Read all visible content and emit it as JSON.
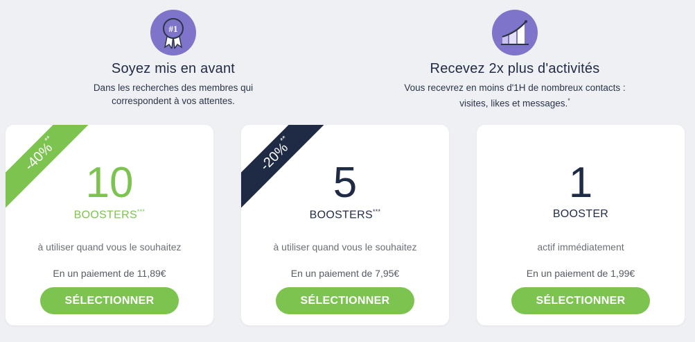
{
  "colors": {
    "background": "#eef0f4",
    "accent_green": "#7cc44f",
    "navy": "#1f2a44",
    "icon_purple": "#7e74c9"
  },
  "features": [
    {
      "icon": "award-ribbon-icon",
      "icon_text": "#1",
      "title": "Soyez mis en avant",
      "line1": "Dans les recherches des membres qui",
      "line2": "correspondent à vos attentes.",
      "footnote": ""
    },
    {
      "icon": "growth-chart-icon",
      "title": "Recevez 2x plus d'activités",
      "line1": "Vous recevrez en moins d'1H de nombreux contacts :",
      "line2": "visites, likes et messages.",
      "footnote": "*"
    }
  ],
  "offers": [
    {
      "ribbon": "-40%",
      "ribbon_mark": "**",
      "ribbon_color": "#7cc44f",
      "count": "10",
      "unit": "BOOSTERS",
      "unit_mark": "***",
      "description": "à utiliser quand vous le souhaitez",
      "price": "En un paiement de 11,89€",
      "button": "SÉLECTIONNER"
    },
    {
      "ribbon": "-20%",
      "ribbon_mark": "**",
      "ribbon_color": "#1f2a44",
      "count": "5",
      "unit": "BOOSTERS",
      "unit_mark": "***",
      "description": "à utiliser quand vous le souhaitez",
      "price": "En un paiement de 7,95€",
      "button": "SÉLECTIONNER"
    },
    {
      "count": "1",
      "unit": "BOOSTER",
      "description": "actif immédiatement",
      "price": "En un paiement de 1,99€",
      "button": "SÉLECTIONNER"
    }
  ]
}
